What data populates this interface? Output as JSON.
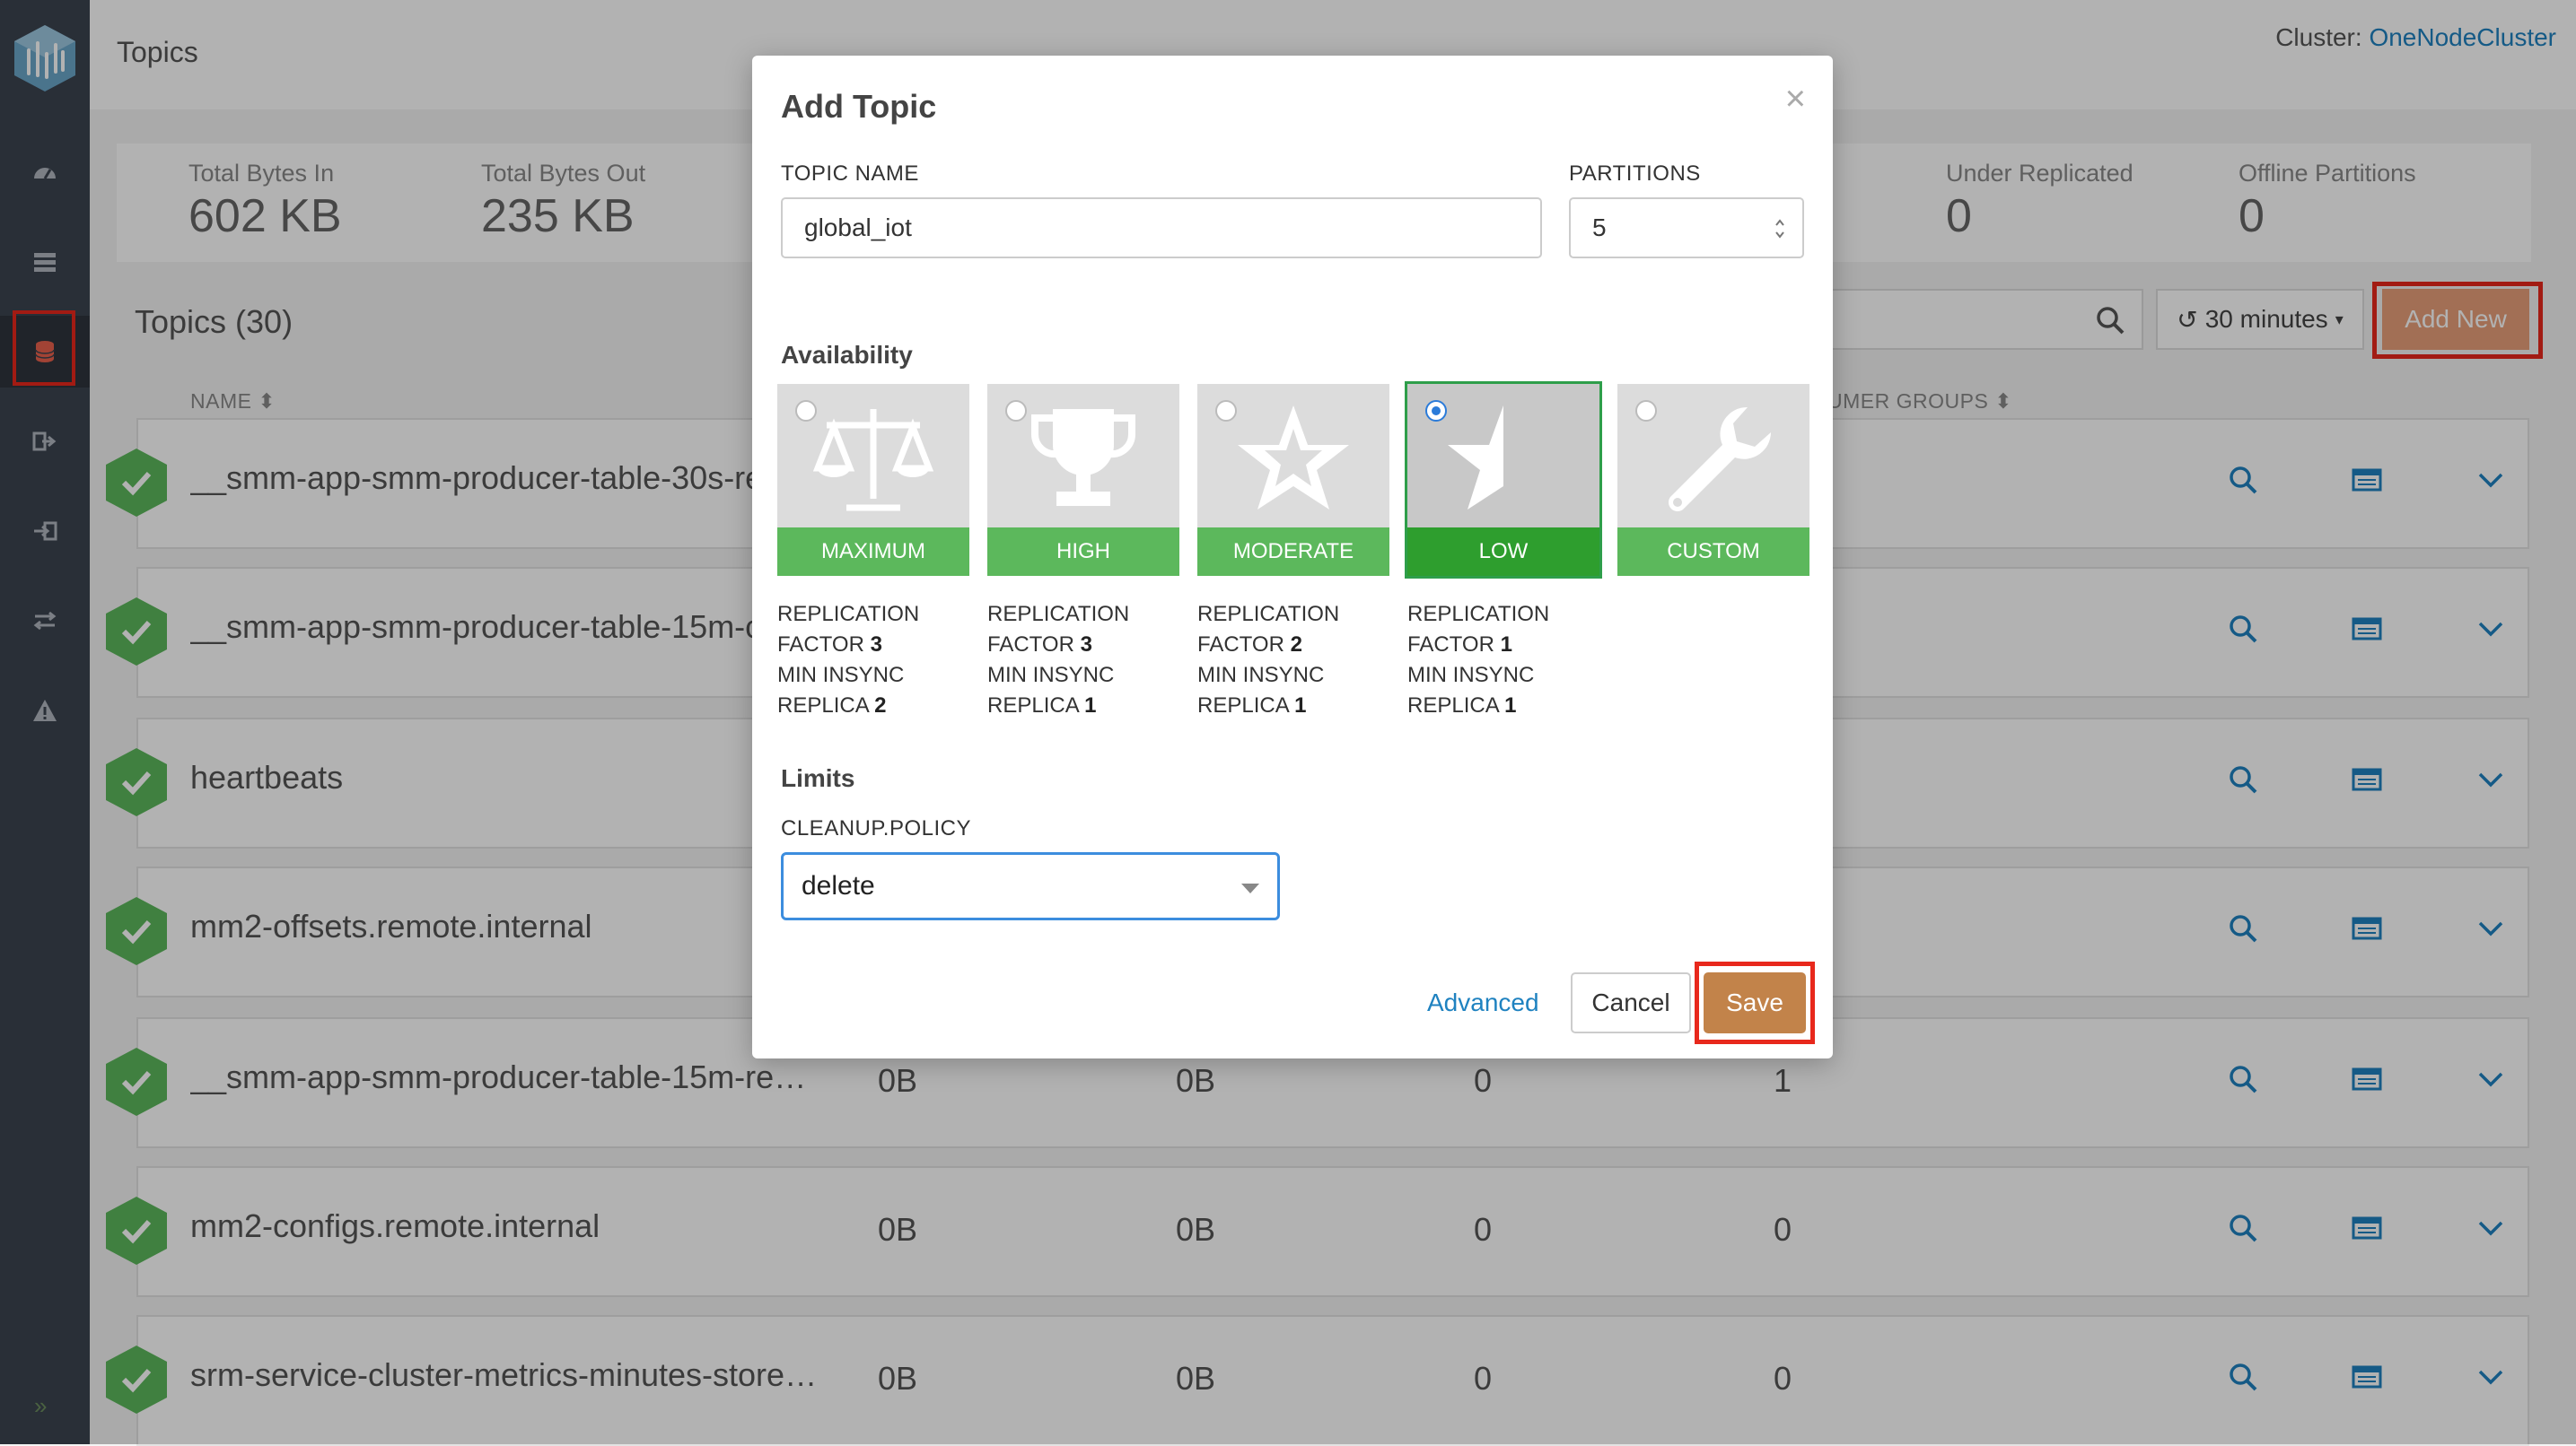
{
  "page": {
    "title": "Topics"
  },
  "cluster": {
    "label": "Cluster:",
    "name": "OneNodeCluster"
  },
  "stats": [
    {
      "label": "Total Bytes In",
      "value": "602 KB"
    },
    {
      "label": "Total Bytes Out",
      "value": "235 KB"
    },
    {
      "label": "Under Replicated",
      "value": "0"
    },
    {
      "label": "Offline Partitions",
      "value": "0"
    }
  ],
  "toolbar": {
    "topics_count": "Topics (30)",
    "time_range": "30 minutes",
    "add_new": "Add New"
  },
  "table": {
    "headers": {
      "name": "NAME",
      "consumer_groups": "UMER GROUPS"
    },
    "rows": [
      {
        "name": "__smm-app-smm-producer-table-30s-re",
        "c1": "",
        "c2": "",
        "c3": "",
        "c4": ""
      },
      {
        "name": "__smm-app-smm-producer-table-15m-c",
        "c1": "",
        "c2": "",
        "c3": "",
        "c4": ""
      },
      {
        "name": "heartbeats",
        "c1": "",
        "c2": "",
        "c3": "",
        "c4": ""
      },
      {
        "name": "mm2-offsets.remote.internal",
        "c1": "",
        "c2": "",
        "c3": "",
        "c4": ""
      },
      {
        "name": "__smm-app-smm-producer-table-15m-repa...",
        "c1": "0B",
        "c2": "0B",
        "c3": "0",
        "c4": "1"
      },
      {
        "name": "mm2-configs.remote.internal",
        "c1": "0B",
        "c2": "0B",
        "c3": "0",
        "c4": "0"
      },
      {
        "name": "srm-service-cluster-metrics-minutes-store-...",
        "c1": "0B",
        "c2": "0B",
        "c3": "0",
        "c4": "0"
      }
    ]
  },
  "modal": {
    "title": "Add Topic",
    "close": "×",
    "topic_name_label": "TOPIC NAME",
    "topic_name_value": "global_iot",
    "partitions_label": "PARTITIONS",
    "partitions_value": "5",
    "availability_heading": "Availability",
    "availability": [
      {
        "label": "MAXIMUM",
        "icon": "balance-scale-icon",
        "selected": false,
        "desc": [
          "REPLICATION",
          "FACTOR",
          "3",
          "MIN INSYNC",
          "REPLICA",
          "2"
        ]
      },
      {
        "label": "HIGH",
        "icon": "trophy-icon",
        "selected": false,
        "desc": [
          "REPLICATION",
          "FACTOR",
          "3",
          "MIN INSYNC",
          "REPLICA",
          "1"
        ]
      },
      {
        "label": "MODERATE",
        "icon": "star-icon",
        "selected": false,
        "desc": [
          "REPLICATION",
          "FACTOR",
          "2",
          "MIN INSYNC",
          "REPLICA",
          "1"
        ]
      },
      {
        "label": "LOW",
        "icon": "half-star-icon",
        "selected": true,
        "desc": [
          "REPLICATION",
          "FACTOR",
          "1",
          "MIN INSYNC",
          "REPLICA",
          "1"
        ]
      },
      {
        "label": "CUSTOM",
        "icon": "wrench-icon",
        "selected": false,
        "desc": []
      }
    ],
    "limits_heading": "Limits",
    "cleanup_label": "CLEANUP.POLICY",
    "cleanup_value": "delete",
    "advanced": "Advanced",
    "cancel": "Cancel",
    "save": "Save"
  },
  "colors": {
    "sidebar": "#3c4450",
    "accent_link": "#1f82c0",
    "status_green": "#5cb85c",
    "selected_green": "#2e9e2e",
    "highlight_red": "#e8281c",
    "save_button": "#c2834a"
  }
}
